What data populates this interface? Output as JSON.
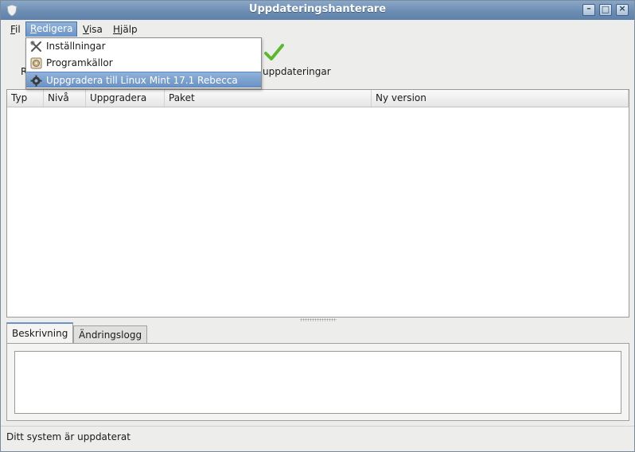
{
  "window": {
    "title": "Uppdateringshanterare"
  },
  "menubar": {
    "items": [
      {
        "label": "Fil",
        "mnemonic": "F",
        "rest": "il"
      },
      {
        "label": "Redigera",
        "mnemonic": "R",
        "rest": "edigera"
      },
      {
        "label": "Visa",
        "mnemonic": "V",
        "rest": "isa"
      },
      {
        "label": "Hjälp",
        "mnemonic": "H",
        "rest": "jälp"
      }
    ]
  },
  "dropdown": {
    "items": [
      {
        "label": "Inställningar",
        "icon": "tools-icon"
      },
      {
        "label": "Programkällor",
        "icon": "software-sources-icon"
      },
      {
        "label": "Uppgradera till Linux Mint 17.1 Rebecca",
        "icon": "gear-icon"
      }
    ]
  },
  "toolbar": {
    "partial_label": "R",
    "install_label": "uppdateringar"
  },
  "table": {
    "columns": [
      "Typ",
      "Nivå",
      "Uppgradera",
      "Paket",
      "Ny version"
    ],
    "rows": []
  },
  "tabs": {
    "description": "Beskrivning",
    "changelog": "Ändringslogg"
  },
  "status": {
    "text": "Ditt system är uppdaterat"
  },
  "colors": {
    "accent": "#6b93c5",
    "titlebar": "#6c8db3",
    "check": "#5cb82e"
  }
}
